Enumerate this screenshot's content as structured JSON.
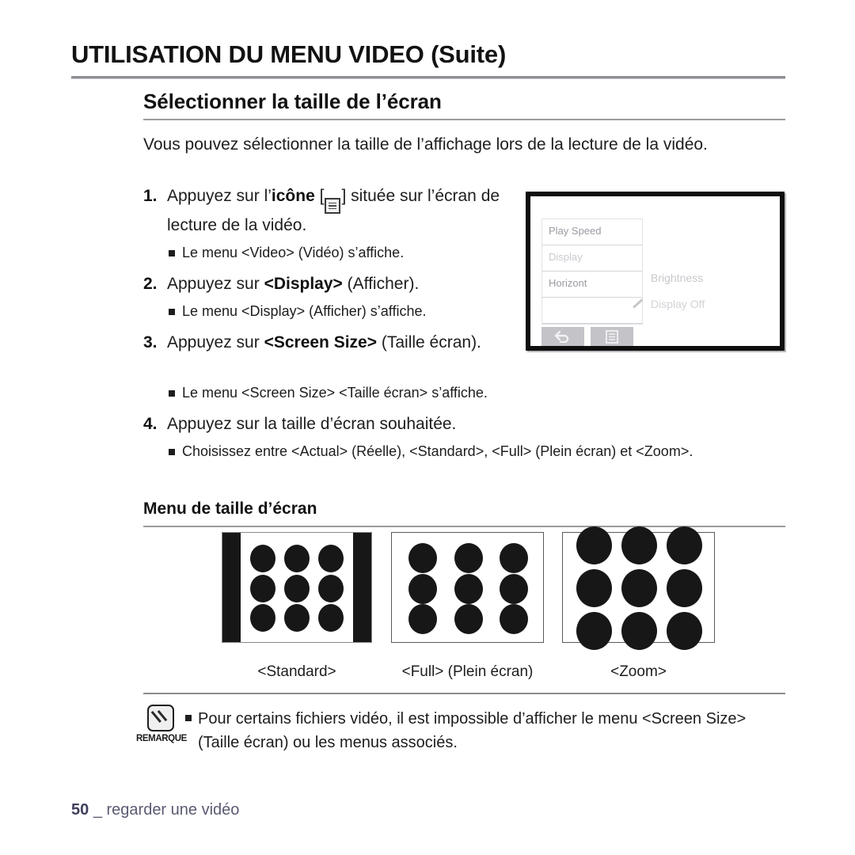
{
  "header": {
    "chapter_title": "UTILISATION DU MENU VIDEO (Suite)",
    "section_title": "Sélectionner la taille de l’écran"
  },
  "intro": "Vous pouvez sélectionner la taille de l’affichage lors de la lecture de la vidéo.",
  "steps": [
    {
      "num": "1.",
      "text_before": "Appuyez sur l’",
      "bold": "icône",
      "icon": "list-menu-icon",
      "text_after": " située sur l’écran de lecture de la vidéo.",
      "sub": "Le menu <Video> (Vidéo) s’affiche."
    },
    {
      "num": "2.",
      "text_before": "Appuyez sur ",
      "bold": "<Display>",
      "text_after": " (Afficher).",
      "sub": "Le menu <Display> (Afficher) s’affiche."
    },
    {
      "num": "3.",
      "text_before": "Appuyez sur ",
      "bold": "<Screen Size>",
      "text_after": " (Taille écran).",
      "sub": "Le menu <Screen Size> <Taille écran> s’affiche."
    },
    {
      "num": "4.",
      "text_before": "Appuyez sur la taille d’écran souhaitée.",
      "bold": "",
      "text_after": "",
      "sub": "Choisissez entre <Actual> (Réelle), <Standard>, <Full> (Plein écran) et <Zoom>."
    }
  ],
  "device": {
    "menu_items": [
      {
        "label": "Play Speed",
        "dim": false
      },
      {
        "label": "Display",
        "dim": true
      },
      {
        "label": "Horizont",
        "dim": false
      },
      {
        "label": "",
        "dim": false
      }
    ],
    "right_labels": [
      "Brightness",
      "Display Off"
    ],
    "buttons": [
      {
        "name": "back-button",
        "icon": "back-arrow-icon"
      },
      {
        "name": "menu-button",
        "icon": "list-menu-icon"
      }
    ]
  },
  "screen_size_menu": {
    "heading": "Menu de taille d’écran",
    "figures": [
      {
        "caption": "<Standard>",
        "mode": "standard"
      },
      {
        "caption": "<Full> (Plein écran)",
        "mode": "full"
      },
      {
        "caption": "<Zoom>",
        "mode": "zoom"
      }
    ]
  },
  "note": {
    "label": "REMARQUE",
    "icon": "note-pencil-icon",
    "text": "Pour certains fichiers vidéo, il est impossible d’afficher le menu <Screen Size> (Taille écran) ou les menus associés."
  },
  "footer": {
    "page_number": "50",
    "separator": "_",
    "label": "regarder une vidéo"
  },
  "colors": {
    "text": "#1d1d1d",
    "rule": "#9b9b9f",
    "footer": "#5a5a72",
    "dot": "#171717",
    "device_frame": "#0e0e0e",
    "device_button": "#c3c3c8"
  }
}
